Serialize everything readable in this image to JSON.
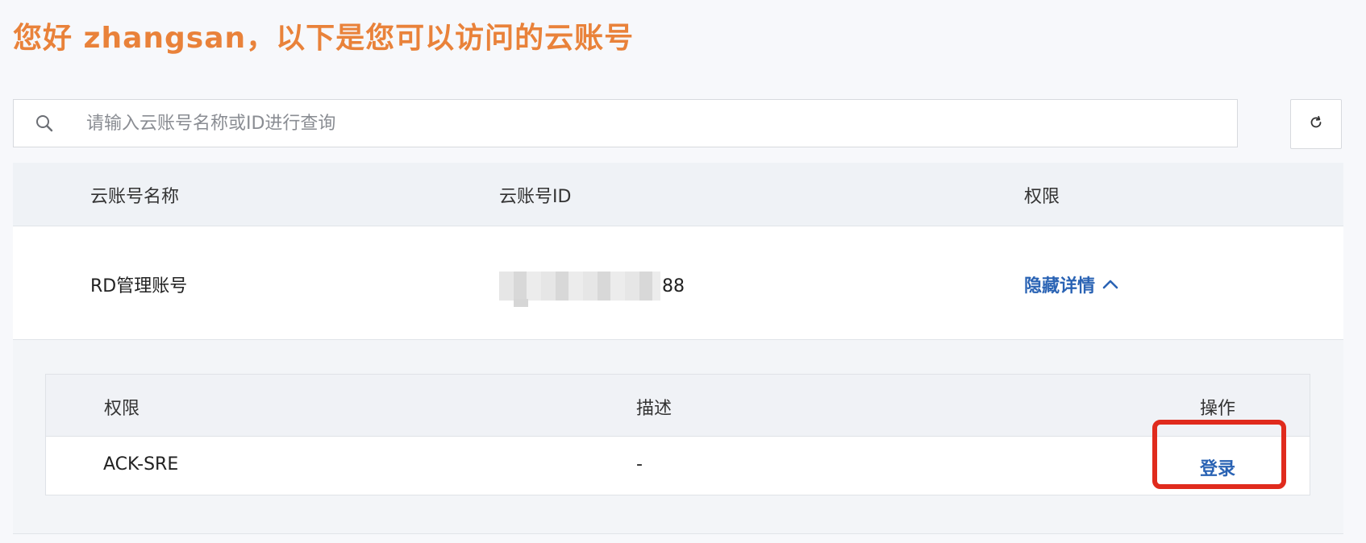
{
  "header": {
    "greeting": "您好 zhangsan，以下是您可以访问的云账号"
  },
  "search": {
    "placeholder": "请输入云账号名称或ID进行查询",
    "value": ""
  },
  "table": {
    "columns": [
      "云账号名称",
      "云账号ID",
      "权限"
    ],
    "rows": [
      {
        "name": "RD管理账号",
        "id_suffix": "88",
        "detail_toggle": "隐藏详情"
      }
    ]
  },
  "permissions": {
    "columns": [
      "权限",
      "描述",
      "操作"
    ],
    "rows": [
      {
        "permission": "ACK-SRE",
        "description": "-",
        "action": "登录"
      }
    ]
  },
  "colors": {
    "accent": "#e9823a",
    "link": "#2a63b4",
    "highlight": "#e02b1d"
  },
  "icons": {
    "search": "search-icon",
    "refresh": "refresh-icon",
    "chevron": "chevron-up-icon"
  }
}
